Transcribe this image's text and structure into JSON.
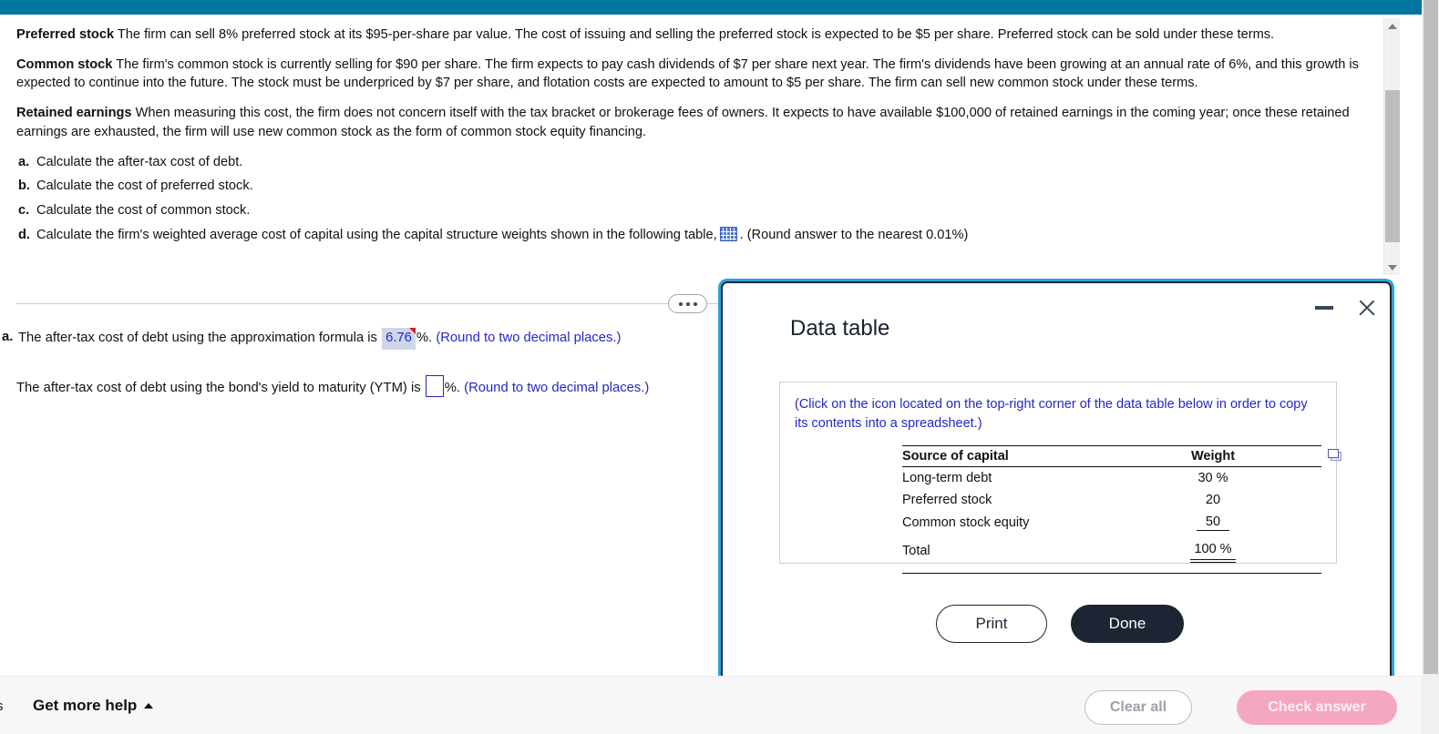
{
  "problem": {
    "paragraphs": [
      {
        "lead": "Preferred stock",
        "body": "The firm can sell 8% preferred stock at its $95-per-share par value.  The cost of issuing and selling the preferred stock is expected to be $5 per share. Preferred stock can be sold under these terms."
      },
      {
        "lead": "Common stock",
        "body": "The firm's common stock is currently selling for $90 per share.  The firm expects to pay cash dividends of $7 per share next year.  The firm's dividends have been growing at an annual rate of 6%, and this growth is expected to continue into the future.  The stock must be underpriced by $7 per share, and flotation costs are expected to amount to $5 per share. The firm can sell new common stock under these terms."
      },
      {
        "lead": "Retained earnings",
        "body": "When measuring this cost, the firm does not concern itself with the tax bracket or brokerage fees of owners.  It expects to have available $100,000 of retained earnings in the coming year; once these retained earnings are exhausted, the firm will use new common stock as the form of common stock equity financing."
      }
    ],
    "questions": [
      {
        "marker": "a.",
        "text": "Calculate the after-tax cost of debt."
      },
      {
        "marker": "b.",
        "text": "Calculate the cost of preferred stock."
      },
      {
        "marker": "c.",
        "text": "Calculate the cost of common stock."
      }
    ],
    "question_d": {
      "marker": "d.",
      "text_before": "Calculate the firm's weighted average cost of capital using the capital structure weights shown in the following table,",
      "icon": "data-table-grid-icon",
      "text_after": ".  (Round answer to the nearest 0.01%)"
    }
  },
  "answers": {
    "row_a": {
      "marker": "a.",
      "text_before": "The after-tax cost of debt using the approximation formula is",
      "value": "6.76",
      "percent": "%.",
      "hint": "(Round to two decimal places.)"
    },
    "row_b": {
      "text_before": "The after-tax cost of debt using the bond's yield to maturity (YTM) is",
      "value": "",
      "percent": "%.",
      "hint": "(Round to two decimal places.)"
    }
  },
  "divider": {
    "ellipsis_label": "more-options"
  },
  "modal": {
    "title": "Data table",
    "minimize_label": "minimize",
    "close_label": "close",
    "note": "(Click on the icon located on the top-right corner of the data table below in order to copy its contents into a spreadsheet.)",
    "copy_icon": "copy-to-spreadsheet-icon",
    "table": {
      "headers": [
        "Source of capital",
        "Weight"
      ],
      "rows": [
        {
          "source": "Long-term debt",
          "weight": "30 %"
        },
        {
          "source": "Preferred stock",
          "weight": "20"
        },
        {
          "source": "Common stock equity",
          "weight": "50"
        }
      ],
      "total": {
        "source": "Total",
        "weight": "100 %"
      }
    },
    "buttons": {
      "print": "Print",
      "done": "Done"
    }
  },
  "bottom": {
    "cut_text": "s",
    "get_more_help": "Get more help",
    "clear_all": "Clear all",
    "check_answer": "Check answer"
  },
  "colors": {
    "header_teal": "#00759E",
    "modal_border_blue": "#29A3E0",
    "modal_inner_navy": "#1d2433",
    "answer_blue": "#2727c4",
    "answer_fill": "#cdd7e8",
    "flag_red": "#e01b1b",
    "check_answer_pink": "#f4a8c0"
  }
}
